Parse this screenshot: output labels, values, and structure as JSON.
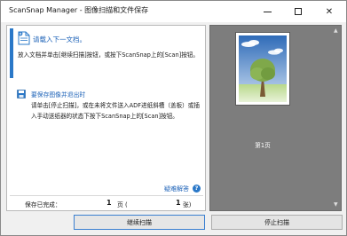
{
  "window": {
    "title": "ScanSnap Manager - 图像扫描和文件保存",
    "minimize_glyph": "",
    "close_glyph": "✕"
  },
  "left_panel": {
    "prompt": "请载入下一文档。",
    "instruction": "放入文档并单击[继续扫描]按钮，或按下ScanSnap上的[Scan]按钮。",
    "save_title": "要保存图像并退出时",
    "save_description": "请单击[停止扫描]，或在未将文件送入ADF进纸斜槽（盖板）或插入手动送纸器的状态下按下ScanSnap上的[Scan]按钮。",
    "help_link": "疑难解答",
    "help_icon_glyph": "?",
    "status": {
      "label": "保存已完成：",
      "pages": "1",
      "page_unit": "页 (",
      "sheets": "1",
      "sheet_unit": "张)"
    }
  },
  "right_panel": {
    "page_caption": "第1页",
    "scroll_up_glyph": "▲",
    "scroll_down_glyph": "▼"
  },
  "buttons": {
    "continue_label": "继续扫描",
    "stop_label": "停止扫描"
  },
  "colors": {
    "accent": "#2a78c8",
    "link": "#1e63b8",
    "preview_bg": "#7d7d7d"
  },
  "icons": [
    "document-icon",
    "save-icon",
    "help-icon",
    "minimize-icon",
    "maximize-icon",
    "close-icon",
    "tree-image"
  ]
}
